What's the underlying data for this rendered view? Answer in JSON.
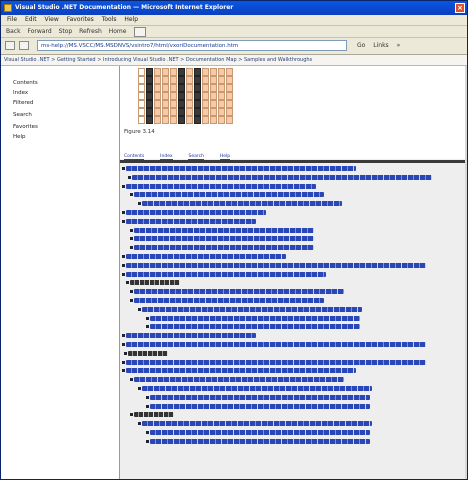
{
  "window": {
    "title": "Visual Studio .NET Documentation — Microsoft Internet Explorer",
    "close_glyph": "×",
    "icon": "ie-icon"
  },
  "menu": [
    "File",
    "Edit",
    "View",
    "Favorites",
    "Tools",
    "Help"
  ],
  "links_bar": {
    "items": [
      "Back",
      "Forward",
      "Stop",
      "Refresh",
      "Home"
    ]
  },
  "address": {
    "value": "ms-help://MS.VSCC/MS.MSDNVS/vsintro7/html/vxoriDocumentation.htm",
    "tools": [
      "Go",
      "Links",
      "»"
    ]
  },
  "path_bar": "Visual Studio .NET > Getting Started > Introducing Visual Studio .NET > Documentation Map > Samples and Walkthroughs",
  "sidebar": {
    "items": [
      "Contents",
      "Index",
      "Filtered",
      "Search",
      "Favorites",
      "Help"
    ]
  },
  "content": {
    "caption": "Figure 3.14",
    "tabs": [
      "Contents",
      "Index",
      "Search",
      "Help"
    ],
    "accent": "#2a47b8",
    "grid_fill": "#f8c9a8",
    "grid_dark": "#3a3a3a"
  }
}
